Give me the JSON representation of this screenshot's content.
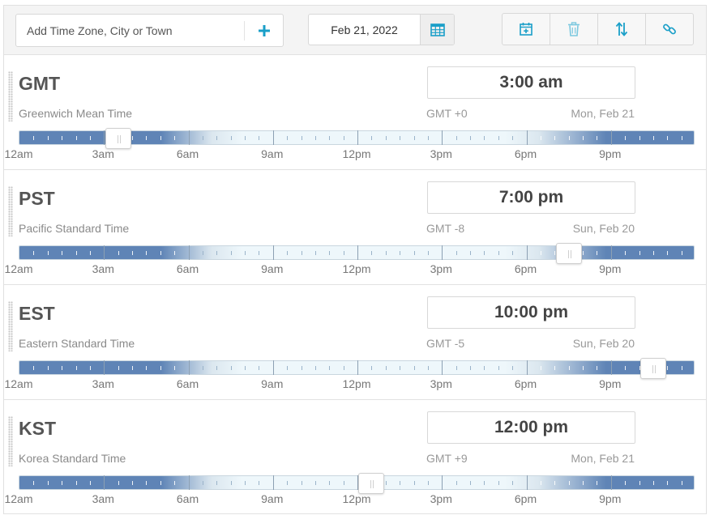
{
  "toolbar": {
    "search_placeholder": "Add Time Zone, City or Town",
    "add_icon": "plus-icon",
    "date": "Feb 21, 2022",
    "calendar_icon": "calendar-grid-icon",
    "actions": [
      {
        "name": "schedule-meeting",
        "icon": "calendar-plus-icon"
      },
      {
        "name": "delete",
        "icon": "trash-icon"
      },
      {
        "name": "sort",
        "icon": "sort-arrows-icon"
      },
      {
        "name": "link",
        "icon": "link-icon"
      }
    ]
  },
  "hour_labels": [
    "12am",
    "3am",
    "6am",
    "9am",
    "12pm",
    "3pm",
    "6pm",
    "9pm"
  ],
  "zones": [
    {
      "abbr": "GMT",
      "name": "Greenwich Mean Time",
      "time": "3:00 am",
      "offset": "GMT +0",
      "date": "Mon, Feb 21",
      "slider_hour": 3
    },
    {
      "abbr": "PST",
      "name": "Pacific Standard Time",
      "time": "7:00 pm",
      "offset": "GMT -8",
      "date": "Sun, Feb 20",
      "slider_hour": 19
    },
    {
      "abbr": "EST",
      "name": "Eastern Standard Time",
      "time": "10:00 pm",
      "offset": "GMT -5",
      "date": "Sun, Feb 20",
      "slider_hour": 22
    },
    {
      "abbr": "KST",
      "name": "Korea Standard Time",
      "time": "12:00 pm",
      "offset": "GMT +9",
      "date": "Mon, Feb 21",
      "slider_hour": 12
    }
  ],
  "colors": {
    "accent": "#1a9fc8",
    "night": "#5f84b6",
    "day": "#eef7fb"
  }
}
